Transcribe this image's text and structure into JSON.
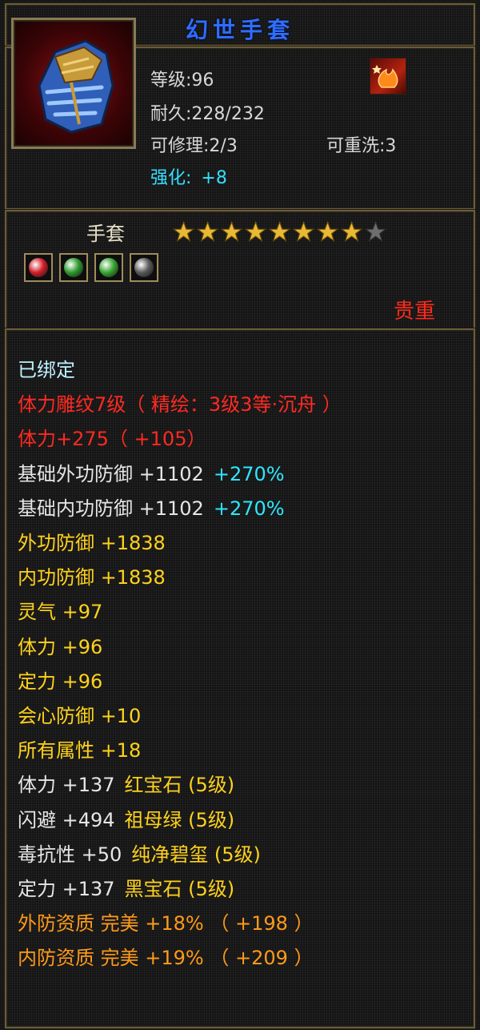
{
  "title": "幻世手套",
  "info": {
    "level_label": "等级:",
    "level_value": "96",
    "durability_label": "耐久:",
    "durability_value": "228/232",
    "repair_label": "可修理:",
    "repair_value": "2/3",
    "rewash_label": "可重洗:",
    "rewash_value": "3",
    "enhance_label": "强化:",
    "enhance_value": "+8"
  },
  "item_type": "手套",
  "stars": {
    "filled": 8,
    "total": 9
  },
  "gems": [
    {
      "icon": "red-gem-icon",
      "color": "#d2202a"
    },
    {
      "icon": "green-gem-icon",
      "color": "#2f9a2f"
    },
    {
      "icon": "green-gem-icon",
      "color": "#3aa632"
    },
    {
      "icon": "black-gem-icon",
      "color": "#5a5a5a"
    }
  ],
  "rarity": "贵重",
  "attributes": [
    {
      "text": "已绑定",
      "color": "cyan"
    },
    {
      "text": "体力雕纹7级（ 精绘：3级3等·沉舟 ）",
      "color": "red"
    },
    {
      "text": "体力+275（ +105）",
      "color": "red"
    },
    {
      "text": "基础外功防御 +1102",
      "extra": "+270%",
      "color": "white"
    },
    {
      "text": "基础内功防御 +1102",
      "extra": "+270%",
      "color": "white"
    },
    {
      "text": "外功防御 +1838",
      "color": "yellow"
    },
    {
      "text": "内功防御 +1838",
      "color": "yellow"
    },
    {
      "text": "灵气 +97",
      "color": "yellow"
    },
    {
      "text": "体力 +96",
      "color": "yellow"
    },
    {
      "text": "定力 +96",
      "color": "yellow"
    },
    {
      "text": "会心防御 +10",
      "color": "yellow"
    },
    {
      "text": "所有属性 +18",
      "color": "yellow"
    },
    {
      "text": "体力 +137",
      "extra": "红宝石 (5级)",
      "color": "white",
      "extra_color": "yellow"
    },
    {
      "text": "闪避 +494",
      "extra": "祖母绿 (5级)",
      "color": "white",
      "extra_color": "yellow"
    },
    {
      "text": "毒抗性 +50",
      "extra": "纯净碧玺 (5级)",
      "color": "white",
      "extra_color": "yellow"
    },
    {
      "text": "定力 +137",
      "extra": "黑宝石 (5级)",
      "color": "white",
      "extra_color": "yellow"
    },
    {
      "text": "外防资质  完美 +18% （ +198 ）",
      "color": "orange"
    },
    {
      "text": "内防资质  完美 +19% （ +209 ）",
      "color": "orange"
    }
  ]
}
